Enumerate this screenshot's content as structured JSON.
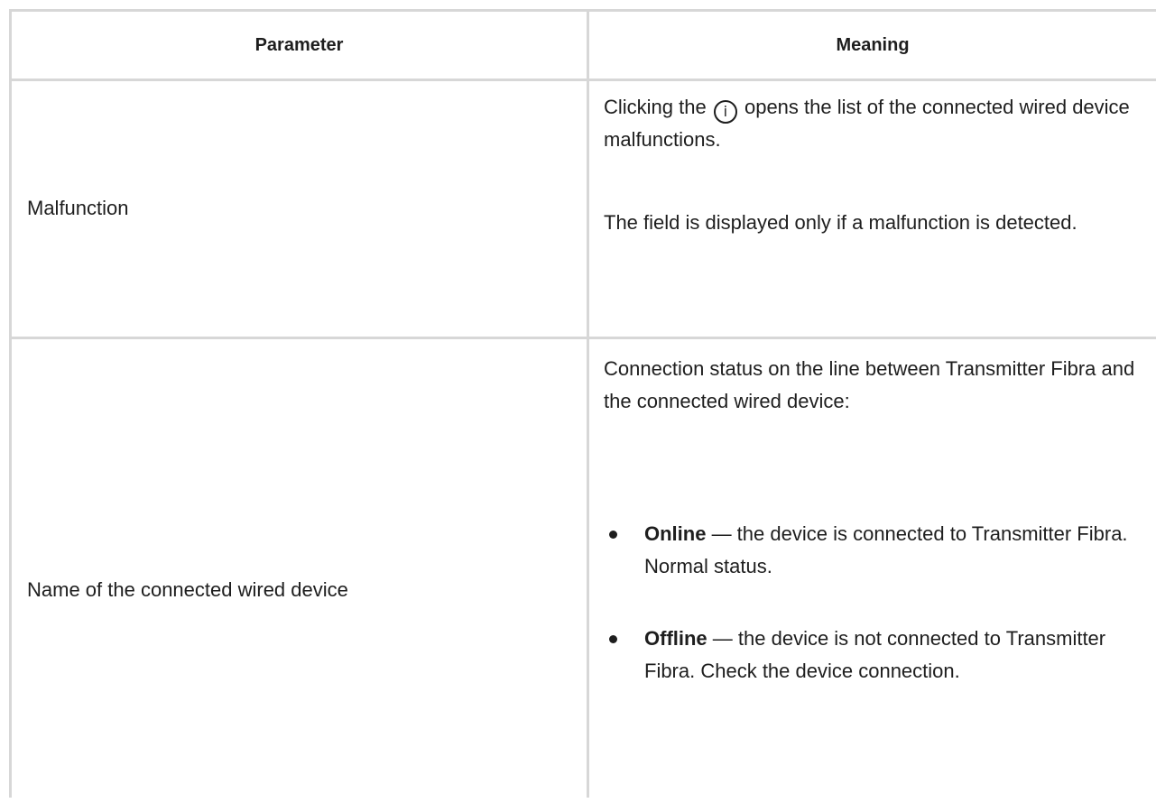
{
  "header": {
    "parameter": "Parameter",
    "meaning": "Meaning"
  },
  "rows": [
    {
      "parameter": "Malfunction",
      "meaning_part1_before_icon": "Clicking the",
      "meaning_icon": "info-icon",
      "meaning_icon_glyph": "i",
      "meaning_part1_after_icon": "opens the list of the connected wired device malfunctions.",
      "meaning_part2": "The field is displayed only if a malfunction is detected."
    },
    {
      "parameter": "Name of the connected wired device",
      "meaning_intro": "Connection status on the line between Transmitter Fibra and the connected wired device:",
      "bullets": [
        {
          "term": "Online",
          "text": " — the device is connected to Transmitter Fibra. Normal status."
        },
        {
          "term": "Offline",
          "text": " — the device is not connected to Transmitter Fibra. Check the device connection."
        }
      ]
    }
  ],
  "colors": {
    "border": "#d7d7d7",
    "text": "#1e1e1e",
    "background": "#ffffff"
  }
}
